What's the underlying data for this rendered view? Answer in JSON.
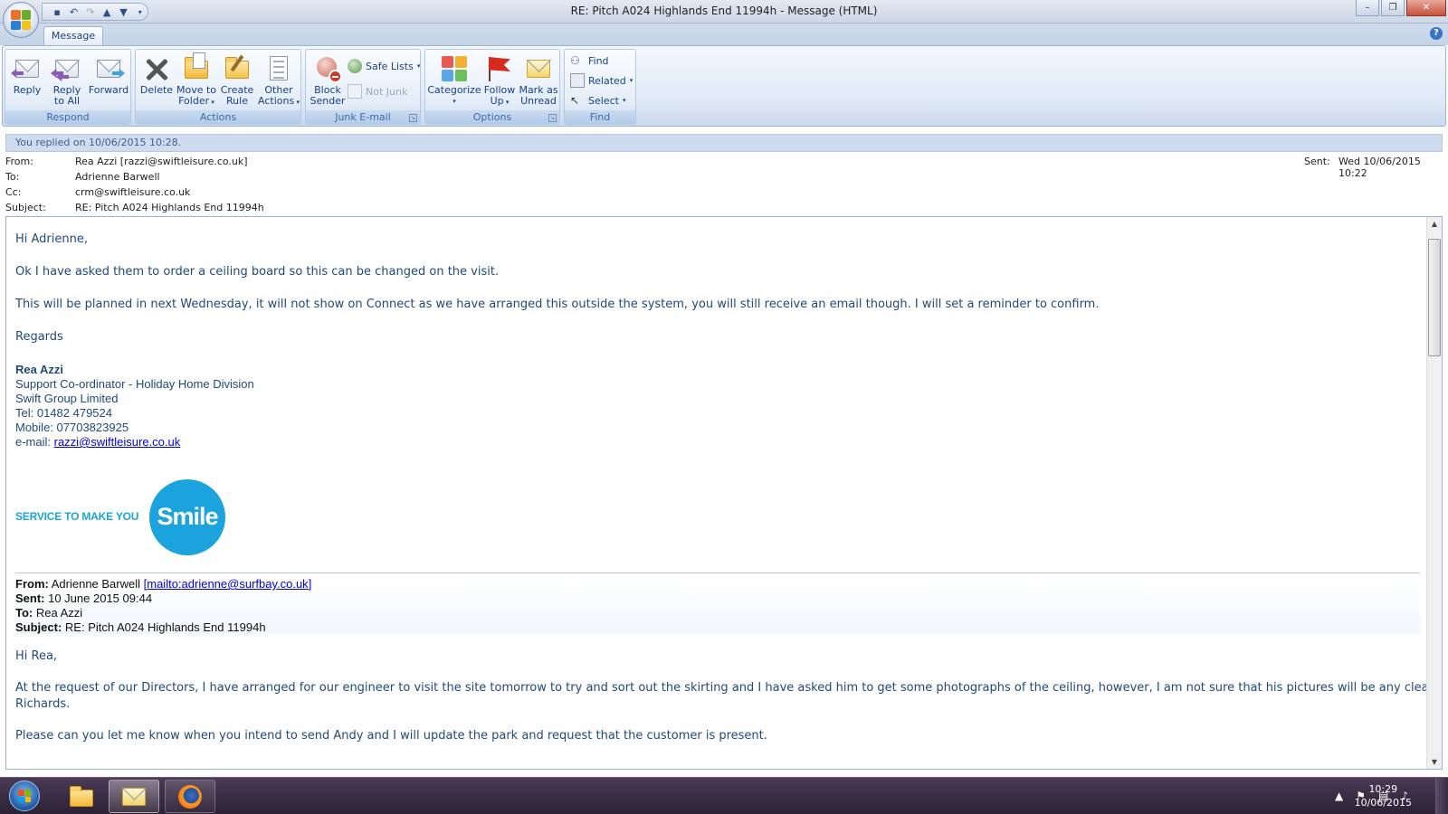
{
  "window": {
    "title": "RE: Pitch A024 Highlands End 11994h  -  Message (HTML)",
    "controls": {
      "minimize": "–",
      "restore": "❐",
      "close": "✕"
    }
  },
  "quick_access": [
    "save-icon",
    "undo-icon",
    "redo-icon",
    "previous-item-icon",
    "next-item-icon",
    "customize-icon"
  ],
  "tabs": [
    {
      "label": "Message"
    }
  ],
  "ribbon": {
    "respond": {
      "label": "Respond",
      "reply": "Reply",
      "reply_all_1": "Reply",
      "reply_all_2": "to All",
      "forward": "Forward"
    },
    "actions": {
      "label": "Actions",
      "delete": "Delete",
      "move_1": "Move to",
      "move_2": "Folder",
      "create_1": "Create",
      "create_2": "Rule",
      "other_1": "Other",
      "other_2": "Actions"
    },
    "junk": {
      "label": "Junk E-mail",
      "block_1": "Block",
      "block_2": "Sender",
      "safe_lists": "Safe Lists",
      "not_junk": "Not Junk"
    },
    "options": {
      "label": "Options",
      "categorize": "Categorize",
      "follow_1": "Follow",
      "follow_2": "Up",
      "mark_1": "Mark as",
      "mark_2": "Unread"
    },
    "find": {
      "label": "Find",
      "find": "Find",
      "related": "Related",
      "select": "Select"
    }
  },
  "info_bar": "You replied on 10/06/2015 10:28.",
  "headers": {
    "from_label": "From:",
    "from_value": "Rea Azzi [razzi@swiftleisure.co.uk]",
    "to_label": "To:",
    "to_value": "Adrienne Barwell",
    "cc_label": "Cc:",
    "cc_value": "crm@swiftleisure.co.uk",
    "subject_label": "Subject:",
    "subject_value": "RE: Pitch A024 Highlands End 11994h",
    "sent_label": "Sent:",
    "sent_value": "Wed 10/06/2015 10:22"
  },
  "body": {
    "greeting": "Hi Adrienne,",
    "para1": "Ok I have asked them to order a ceiling board so this can be changed on the visit.",
    "para2": "This will be planned in next Wednesday, it will not show on Connect as we have arranged this outside the system, you will still receive an email though. I will set a reminder to confirm.",
    "regards": "Regards",
    "signature": {
      "name": "Rea Azzi",
      "title": "Support Co-ordinator - Holiday Home Division",
      "company": "Swift Group Limited",
      "tel": "Tel: 01482 479524",
      "mobile": "Mobile: 07703823925",
      "email_label": "e-mail: ",
      "email": "razzi@swiftleisure.co.uk",
      "banner_text": "SERVICE TO MAKE YOU",
      "banner_word": "Smile"
    },
    "forwarded": {
      "from_label": "From:",
      "from_name": " Adrienne Barwell ",
      "from_link": "mailto:adrienne@surfbay.co.uk",
      "sent_label": "Sent:",
      "sent_value": " 10 June 2015 09:44",
      "to_label": "To:",
      "to_value": " Rea Azzi",
      "subject_label": "Subject:",
      "subject_value": " RE: Pitch A024 Highlands End 11994h"
    },
    "greeting2": "Hi Rea,",
    "para3_line1": "At the request of our Directors, I have arranged for our engineer to visit the site tomorrow to try and sort out the skirting and I have asked him to get some photographs of the ceiling, however, I am not sure that his pictures will be any clearer than",
    "para3_line2": "Richards.",
    "para4": "Please can you let me know when you intend to send Andy and I will update the park and request that the customer is present."
  },
  "taskbar": {
    "apps": [
      "start-orb",
      "windows-explorer-icon",
      "outlook-icon",
      "firefox-icon"
    ],
    "clock_time": "10:29",
    "clock_date": "10/06/2015"
  },
  "colors": {
    "ribbon_text": "#15428b",
    "body_text": "#1f497d",
    "smile_blue": "#1aa3dc"
  }
}
